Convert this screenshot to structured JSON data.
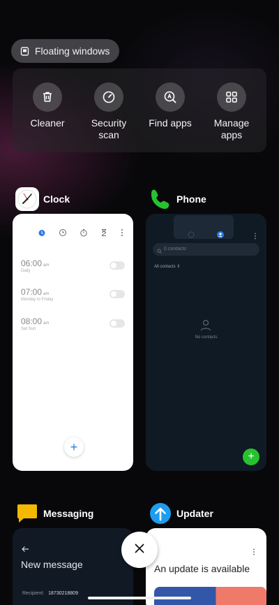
{
  "floating_windows": {
    "label": "Floating windows",
    "icon": "floating-window-icon"
  },
  "shortcuts": [
    {
      "label": "Cleaner",
      "icon": "trash-icon"
    },
    {
      "label": "Security\nscan",
      "icon": "gauge-icon"
    },
    {
      "label": "Find apps",
      "icon": "search-apps-icon"
    },
    {
      "label": "Manage\napps",
      "icon": "grid-icon"
    }
  ],
  "apps": {
    "clock": {
      "name": "Clock",
      "alarms": [
        {
          "time": "06:00",
          "ampm": "am",
          "repeat": "Daily"
        },
        {
          "time": "07:00",
          "ampm": "am",
          "repeat": "Monday to Friday"
        },
        {
          "time": "08:00",
          "ampm": "am",
          "repeat": "Sat Sun"
        }
      ],
      "accent": "#2c7be5"
    },
    "phone": {
      "name": "Phone",
      "search_placeholder": "0 contacts",
      "filter": "All contacts",
      "empty_text": "No contacts",
      "accent": "#27c22f"
    },
    "messaging": {
      "name": "Messaging",
      "title": "New message",
      "recipient_label": "Recipient:",
      "recipient_value": "18730218809"
    },
    "updater": {
      "name": "Updater",
      "title": "An update is available"
    }
  },
  "close_button": {
    "icon": "close-icon"
  }
}
